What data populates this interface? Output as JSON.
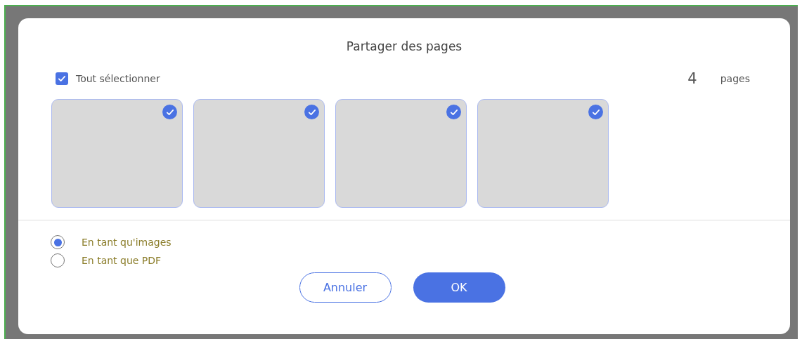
{
  "dialog": {
    "title": "Partager des pages"
  },
  "select_all": {
    "label": "Tout sélectionner",
    "checked": true
  },
  "page_count": {
    "value": "4",
    "unit": "pages"
  },
  "pages": [
    {
      "selected": true
    },
    {
      "selected": true
    },
    {
      "selected": true
    },
    {
      "selected": true
    }
  ],
  "formats": [
    {
      "label": "En tant qu'images",
      "selected": true
    },
    {
      "label": "En tant que PDF",
      "selected": false
    }
  ],
  "buttons": [
    {
      "label": "Annuler",
      "kind": "secondary"
    },
    {
      "label": "OK",
      "kind": "primary"
    }
  ]
}
